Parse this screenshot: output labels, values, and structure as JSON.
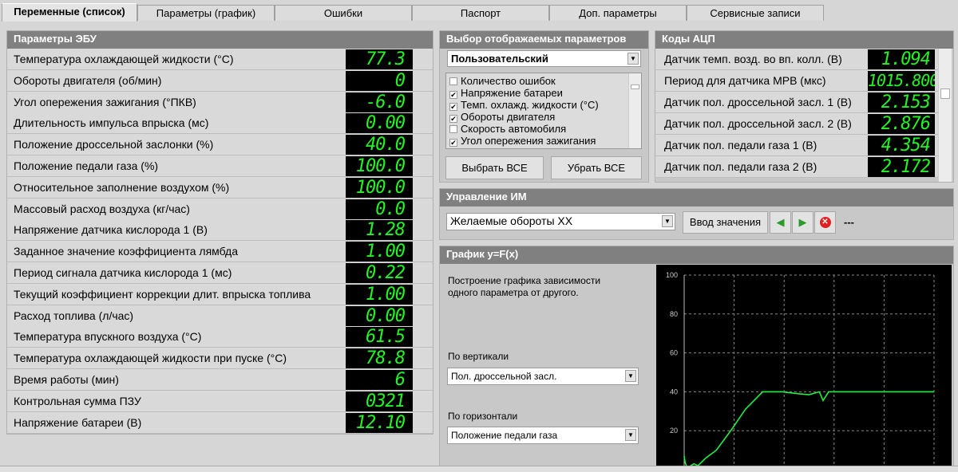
{
  "tabs": [
    "Переменные (список)",
    "Параметры (график)",
    "Ошибки",
    "Паспорт",
    "Доп. параметры",
    "Сервисные записи"
  ],
  "ecu": {
    "title": "Параметры ЭБУ",
    "rows": [
      {
        "label": "Температура охлаждающей жидкости (°C)",
        "value": "77.3"
      },
      {
        "label": "Обороты двигателя (об/мин)",
        "value": "0"
      },
      {
        "label": "Угол опережения зажигания (°ПКВ)",
        "value": "-6.0"
      },
      {
        "label": "Длительность импульса впрыска (мс)",
        "value": "0.00"
      },
      {
        "label": "Положение дроссельной заслонки (%)",
        "value": "40.0"
      },
      {
        "label": "Положение педали газа (%)",
        "value": "100.0"
      },
      {
        "label": "Относительное заполнение воздухом (%)",
        "value": "100.0"
      },
      {
        "label": "Массовый расход воздуха (кг/час)",
        "value": "0.0"
      },
      {
        "label": "Напряжение датчика кислорода 1 (В)",
        "value": "1.28"
      },
      {
        "label": "Заданное значение коэффициента лямбда",
        "value": "1.00"
      },
      {
        "label": "Период сигнала датчика кислорода 1 (мс)",
        "value": "0.22"
      },
      {
        "label": "Текущий коэффициент коррекции длит. впрыска топлива",
        "value": "1.00"
      },
      {
        "label": "Расход топлива (л/час)",
        "value": "0.00"
      },
      {
        "label": "Температура впускного воздуха (°C)",
        "value": "61.5"
      },
      {
        "label": "Температура охлаждающей жидкости при пуске (°C)",
        "value": "78.8"
      },
      {
        "label": "Время работы (мин)",
        "value": "6"
      },
      {
        "label": "Контрольная сумма ПЗУ",
        "value": "0321"
      },
      {
        "label": "Напряжение батареи (В)",
        "value": "12.10"
      }
    ]
  },
  "selector": {
    "title": "Выбор отображаемых параметров",
    "preset": "Пользовательский",
    "items": [
      {
        "label": "Количество ошибок",
        "checked": false
      },
      {
        "label": "Напряжение батареи",
        "checked": true
      },
      {
        "label": "Темп. охлажд. жидкости (°C)",
        "checked": true
      },
      {
        "label": "Обороты двигателя",
        "checked": true
      },
      {
        "label": "Скорость автомобиля",
        "checked": false
      },
      {
        "label": "Угол опережения зажигания",
        "checked": true
      }
    ],
    "select_all": "Выбрать ВСЕ",
    "deselect_all": "Убрать ВСЕ"
  },
  "adc": {
    "title": "Коды АЦП",
    "rows": [
      {
        "label": "Датчик темп. возд. во вп. колл. (В)",
        "value": "1.094"
      },
      {
        "label": "Период для датчика МРВ (мкс)",
        "value": "1015.800"
      },
      {
        "label": "Датчик пол. дроссельной засл. 1 (В)",
        "value": "2.153"
      },
      {
        "label": "Датчик пол. дроссельной засл. 2 (В)",
        "value": "2.876"
      },
      {
        "label": "Датчик пол. педали газа 1 (В)",
        "value": "4.354"
      },
      {
        "label": "Датчик пол. педали газа 2 (В)",
        "value": "2.172"
      }
    ]
  },
  "control": {
    "title": "Управление ИМ",
    "selected": "Желаемые обороты ХХ",
    "enter_label": "Ввод значения",
    "status": "---"
  },
  "graph": {
    "title": "График y=F(x)",
    "description": "Построение графика зависимости одного параметра от другого.",
    "vertical_label": "По вертикали",
    "vertical_value": "Пол. дроссельной засл.",
    "horizontal_label": "По горизонтали",
    "horizontal_value": "Положение педали газа"
  },
  "chart_data": {
    "type": "line",
    "ylim": [
      0,
      100
    ],
    "xlim": [
      0,
      100
    ],
    "yticks": [
      "20",
      "40",
      "60",
      "80",
      "100"
    ],
    "grid": true,
    "color": "#22ee44",
    "x": [
      0,
      0.4,
      1.3,
      3.9,
      5.5,
      8.7,
      12.9,
      19.2,
      24.5,
      31.4,
      39.3,
      45.6,
      49.9,
      54.1,
      55.6,
      57.8,
      66.7,
      99.4,
      100
    ],
    "y": [
      7,
      3.5,
      1,
      3,
      2,
      6,
      10,
      21,
      31,
      40,
      40,
      39,
      38.5,
      40,
      35.5,
      40,
      40,
      40,
      40
    ]
  }
}
